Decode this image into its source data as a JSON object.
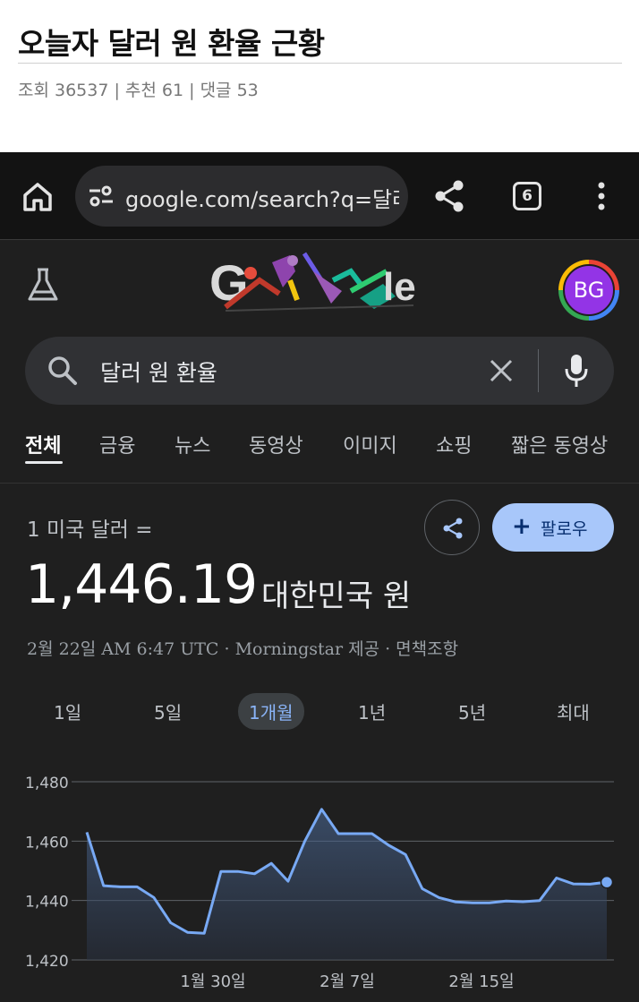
{
  "post": {
    "title": "오늘자 달러 원 환율 근황",
    "meta": "조회 36537 | 추천 61 | 댓글 53"
  },
  "browser": {
    "url": "google.com/search?q=달러",
    "tab_count": "6"
  },
  "account": {
    "initials": "BG"
  },
  "search": {
    "query": "달러 원 환율"
  },
  "tabs": [
    {
      "label": "전체",
      "active": true
    },
    {
      "label": "금융"
    },
    {
      "label": "뉴스"
    },
    {
      "label": "동영상"
    },
    {
      "label": "이미지"
    },
    {
      "label": "쇼핑"
    },
    {
      "label": "짧은 동영상"
    }
  ],
  "rate": {
    "label": "1 미국 달러 =",
    "value": "1,446.19",
    "currency": "대한민국 원",
    "meta": "2월 22일 AM 6:47 UTC · Morningstar 제공 · 면책조항",
    "follow_label": "팔로우"
  },
  "periods": [
    "1일",
    "5일",
    "1개월",
    "1년",
    "5년",
    "최대"
  ],
  "active_period": "1개월",
  "colors": {
    "line": "#78a9f4",
    "accent": "#8ab4f8",
    "follow_bg": "#a8c7fa"
  },
  "chart_data": {
    "type": "line",
    "ylim": [
      1420,
      1480
    ],
    "yticks": [
      "1,480",
      "1,460",
      "1,440",
      "1,420"
    ],
    "xtick_labels": [
      "1월 30일",
      "2월 7일",
      "2월 15일"
    ],
    "series": [
      {
        "values": [
          1463,
          1445,
          1444.6,
          1444.6,
          1441,
          1432.5,
          1429.3,
          1429,
          1449.8,
          1449.8,
          1449,
          1452.5,
          1446.5,
          1460,
          1470.7,
          1462.5,
          1462.5,
          1462.5,
          1458.6,
          1455.5,
          1444,
          1441,
          1439.5,
          1439.2,
          1439.2,
          1439.8,
          1439.6,
          1440,
          1447.6,
          1445.6,
          1445.5,
          1446.19
        ]
      }
    ]
  }
}
